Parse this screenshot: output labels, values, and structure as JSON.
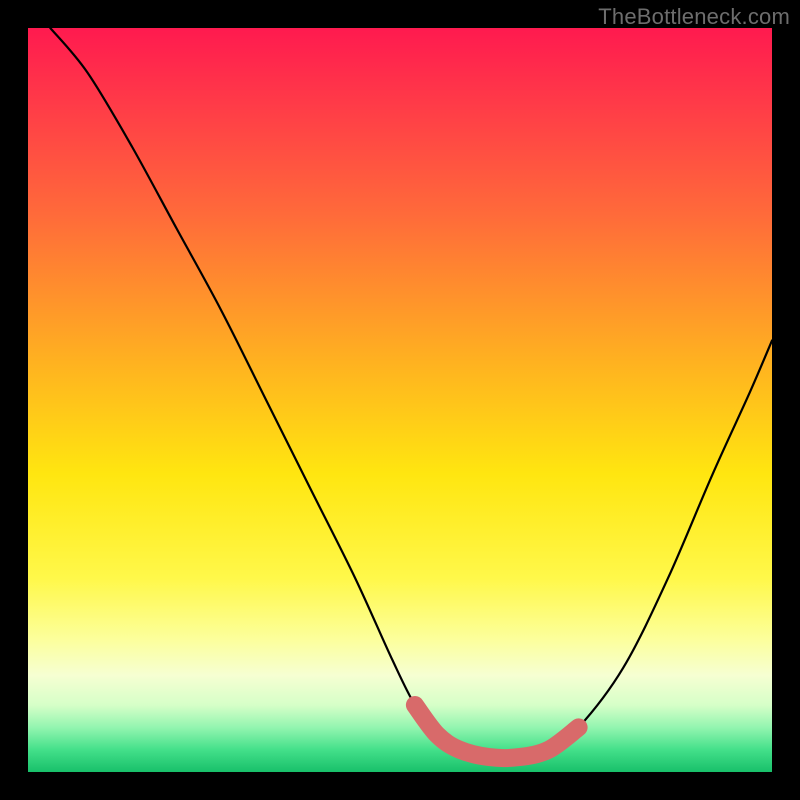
{
  "watermark": "TheBottleneck.com",
  "colors": {
    "background": "#000000",
    "curve_thin": "#000000",
    "curve_thick": "#d86a6a",
    "gradient_stops": [
      "#ff1a4f",
      "#ff3a48",
      "#ff6a3a",
      "#ffb220",
      "#ffe610",
      "#fff84a",
      "#fcff9a",
      "#f6ffd2",
      "#d6ffc8",
      "#93f5b0",
      "#44e08a",
      "#18c06a"
    ]
  },
  "chart_data": {
    "type": "line",
    "title": "",
    "xlabel": "",
    "ylabel": "",
    "x_range": [
      0,
      100
    ],
    "y_range": [
      0,
      100
    ],
    "annotations": [
      "TheBottleneck.com"
    ],
    "series": [
      {
        "name": "bottleneck-curve",
        "x": [
          3,
          8,
          14,
          20,
          26,
          32,
          38,
          44,
          49,
          52,
          55,
          58,
          62,
          66,
          70,
          74,
          80,
          86,
          92,
          97,
          100
        ],
        "y": [
          100,
          94,
          84,
          73,
          62,
          50,
          38,
          26,
          15,
          9,
          5,
          3,
          2,
          2,
          3,
          6,
          14,
          26,
          40,
          51,
          58
        ]
      }
    ],
    "highlight_segment": {
      "name": "optimal-range",
      "x": [
        52,
        55,
        58,
        62,
        66,
        70,
        74
      ],
      "y": [
        9,
        5,
        3,
        2,
        2,
        3,
        6
      ]
    }
  }
}
